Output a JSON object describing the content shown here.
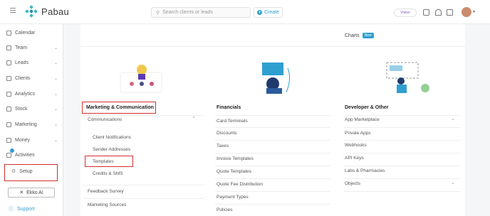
{
  "app": {
    "name": "Pabau"
  },
  "header": {
    "search_placeholder": "Search clients or leads",
    "create_label": "Create",
    "vision_label": "Vision"
  },
  "sidebar": {
    "items": [
      {
        "label": "Calendar"
      },
      {
        "label": "Team"
      },
      {
        "label": "Leads"
      },
      {
        "label": "Clients"
      },
      {
        "label": "Analytics"
      },
      {
        "label": "Stock"
      },
      {
        "label": "Marketing"
      },
      {
        "label": "Money"
      },
      {
        "label": "Activities"
      }
    ],
    "setup_label": "Setup",
    "ekko_label": "Ekko AI",
    "support_label": "Support"
  },
  "top_strip": {
    "charts_label": "Charts",
    "new_badge": "New"
  },
  "columns": {
    "marketing": {
      "title": "Marketing & Communication",
      "communications": "Communications",
      "sub_items": [
        "Client Notifications",
        "Sender Addresses",
        "Templates",
        "Credits & SMS"
      ],
      "more_items": [
        "Feedback Survey",
        "Marketing Sources"
      ]
    },
    "financials": {
      "title": "Financials",
      "items": [
        "Card Terminals",
        "Discounts",
        "Taxes",
        "Invoice Templates",
        "Quote Templates",
        "Quote Fee Distribution",
        "Payment Types",
        "Policies"
      ]
    },
    "developer": {
      "title": "Developer & Other",
      "items": [
        "App Marketplace",
        "Private Apps",
        "Webhooks",
        "API Keys",
        "Labs & Pharmacies",
        "Objects"
      ]
    }
  },
  "colors": {
    "accent": "#2f9fd0",
    "highlight": "#d32f2f"
  }
}
